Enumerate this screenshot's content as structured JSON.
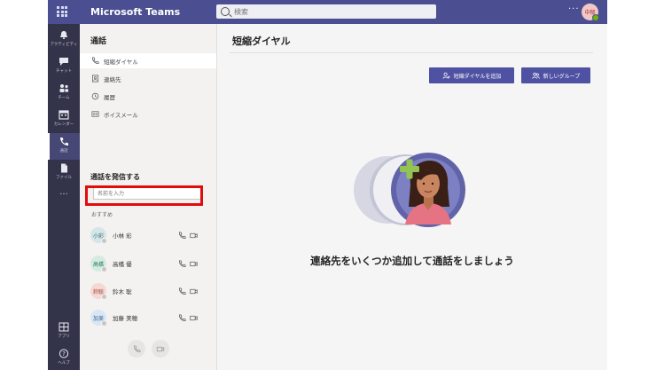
{
  "app": {
    "title": "Microsoft Teams"
  },
  "search": {
    "placeholder": "検索"
  },
  "user": {
    "initials": "中郁"
  },
  "rail": {
    "items": [
      {
        "label": "アクティビティ",
        "icon": "bell-icon"
      },
      {
        "label": "チャット",
        "icon": "chat-icon"
      },
      {
        "label": "チーム",
        "icon": "teams-icon"
      },
      {
        "label": "カレンダー",
        "icon": "calendar-icon"
      },
      {
        "label": "通話",
        "icon": "phone-icon",
        "active": true
      },
      {
        "label": "ファイル",
        "icon": "file-icon"
      },
      {
        "label": "アプリ",
        "icon": "apps-icon"
      },
      {
        "label": "ヘルプ",
        "icon": "help-icon"
      }
    ]
  },
  "calls": {
    "title": "通話",
    "nav": [
      {
        "label": "短縮ダイヤル",
        "icon": "speed-dial-icon",
        "selected": true
      },
      {
        "label": "連絡先",
        "icon": "contacts-icon"
      },
      {
        "label": "履歴",
        "icon": "history-icon"
      },
      {
        "label": "ボイスメール",
        "icon": "voicemail-icon"
      }
    ],
    "make_call_title": "通話を発信する",
    "name_input": {
      "placeholder": "名前を入力"
    },
    "recommended_label": "おすすめ",
    "contacts": [
      {
        "initials": "小彩",
        "name": "小林 彩",
        "avatar_bg": "#d5e5e8",
        "avatar_fg": "#3c6b74"
      },
      {
        "initials": "高橋",
        "name": "高橋 優",
        "avatar_bg": "#d3ebe3",
        "avatar_fg": "#2e7a5c"
      },
      {
        "initials": "鈴聡",
        "name": "鈴木 聡",
        "avatar_bg": "#f5d8d4",
        "avatar_fg": "#a14537"
      },
      {
        "initials": "加美",
        "name": "加藤 美穂",
        "avatar_bg": "#d9e6f3",
        "avatar_fg": "#3b6592"
      }
    ]
  },
  "main": {
    "title": "短縮ダイヤル",
    "add_speed_dial_label": "短縮ダイヤルを追加",
    "new_group_label": "新しいグループ",
    "empty_message": "連絡先をいくつか追加して通話をしましょう"
  },
  "colors": {
    "header": "#4b4f91",
    "rail": "#33344a",
    "accent": "#4f52a3",
    "highlight": "#e30c0c",
    "plus": "#92c353"
  }
}
